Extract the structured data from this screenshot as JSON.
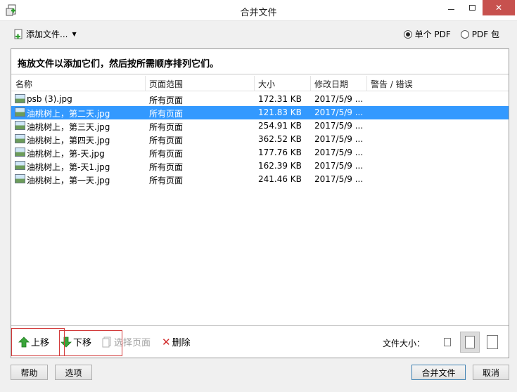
{
  "window": {
    "title": "合并文件"
  },
  "toolbar": {
    "add_files_label": "添加文件...",
    "output_options": [
      {
        "label": "单个 PDF",
        "selected": true
      },
      {
        "label": "PDF 包",
        "selected": false
      }
    ]
  },
  "instruction": "拖放文件以添加它们，然后按所需顺序排列它们。",
  "columns": [
    "名称",
    "页面范围",
    "大小",
    "修改日期",
    "警告 / 错误"
  ],
  "files": [
    {
      "name": "psb (3).jpg",
      "range": "所有页面",
      "size": "172.31 KB",
      "date": "2017/5/9 ...",
      "warning": "",
      "selected": false
    },
    {
      "name": "油桃树上，第二天.jpg",
      "range": "所有页面",
      "size": "121.83 KB",
      "date": "2017/5/9 ...",
      "warning": "",
      "selected": true
    },
    {
      "name": "油桃树上，第三天.jpg",
      "range": "所有页面",
      "size": "254.91 KB",
      "date": "2017/5/9 ...",
      "warning": "",
      "selected": false
    },
    {
      "name": "油桃树上，第四天.jpg",
      "range": "所有页面",
      "size": "362.52 KB",
      "date": "2017/5/9 ...",
      "warning": "",
      "selected": false
    },
    {
      "name": "油桃树上，第-天.jpg",
      "range": "所有页面",
      "size": "177.76 KB",
      "date": "2017/5/9 ...",
      "warning": "",
      "selected": false
    },
    {
      "name": "油桃树上，第-天1.jpg",
      "range": "所有页面",
      "size": "162.39 KB",
      "date": "2017/5/9 ...",
      "warning": "",
      "selected": false
    },
    {
      "name": "油桃树上，第一天.jpg",
      "range": "所有页面",
      "size": "241.46 KB",
      "date": "2017/5/9 ...",
      "warning": "",
      "selected": false
    }
  ],
  "actions": {
    "move_up": "上移",
    "move_down": "下移",
    "choose_pages": "选择页面",
    "delete": "删除",
    "file_size_label": "文件大小："
  },
  "footer": {
    "help": "帮助",
    "options": "选项",
    "combine": "合并文件",
    "cancel": "取消"
  },
  "colors": {
    "selection": "#3399ff",
    "close_button": "#c7514e",
    "annotation": "#d23a3a"
  }
}
